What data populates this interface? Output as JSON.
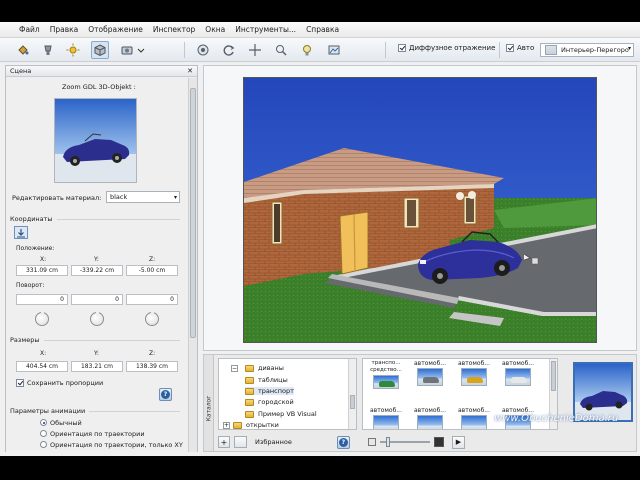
{
  "menu": [
    "Файл",
    "Правка",
    "Отображение",
    "Инспектор",
    "Окна",
    "Инструменты...",
    "Справка"
  ],
  "toolbar": {
    "diffuse_label": "Диффузное отражение",
    "diffuse_checked": true,
    "auto_label": "Авто",
    "auto_checked": true,
    "view_value": "Интерьер-Перегоро"
  },
  "scene_panel": {
    "title": "Сцена",
    "object_label": "Zoom GDL 3D-Objekt :",
    "edit_material_label": "Редактировать материал:",
    "material_value": "black",
    "coords_section": "Координаты",
    "position_label": "Положение:",
    "axes": [
      "X:",
      "Y:",
      "Z:"
    ],
    "position": [
      "331.09 cm",
      "-339.22 cm",
      "-5.00 cm"
    ],
    "rotation_label": "Поворот:",
    "rotation": [
      "0",
      "0",
      "0"
    ],
    "size_section": "Размеры",
    "size": [
      "404.54 cm",
      "183.21 cm",
      "138.39 cm"
    ],
    "keep_proportions": "Сохранить пропорции",
    "keep_proportions_checked": true,
    "anim_section": "Параметры анимации",
    "anim_options": [
      "Обычный",
      "Ориентация по траектории",
      "Ориентация по траектории, только XY"
    ],
    "anim_selected": 0,
    "help_label": "?"
  },
  "catalog": {
    "tab_label": "Каталог",
    "tree": [
      "диваны",
      "таблицы",
      "транспорт",
      "городской",
      "Пример VB Visual",
      "открытки"
    ],
    "favorites_label": "Избранное",
    "items_row1": [
      "транспо... средство...",
      "автомоб...",
      "автомоб...",
      "автомоб..."
    ],
    "items_row2": [
      "автомоб...",
      "автомоб...",
      "автомоб...",
      "автомоб..."
    ],
    "watermark": "www.ObuchenieDoma.ru",
    "help_label": "?",
    "expander_plus": "+",
    "expander_minus": "−",
    "play_symbol": "▶"
  },
  "colors": {
    "sky": "#2a56c4",
    "grass": "#3b7f2a",
    "brick": "#b0673c",
    "roof": "#c99b83",
    "car": "#2d2f9a"
  }
}
